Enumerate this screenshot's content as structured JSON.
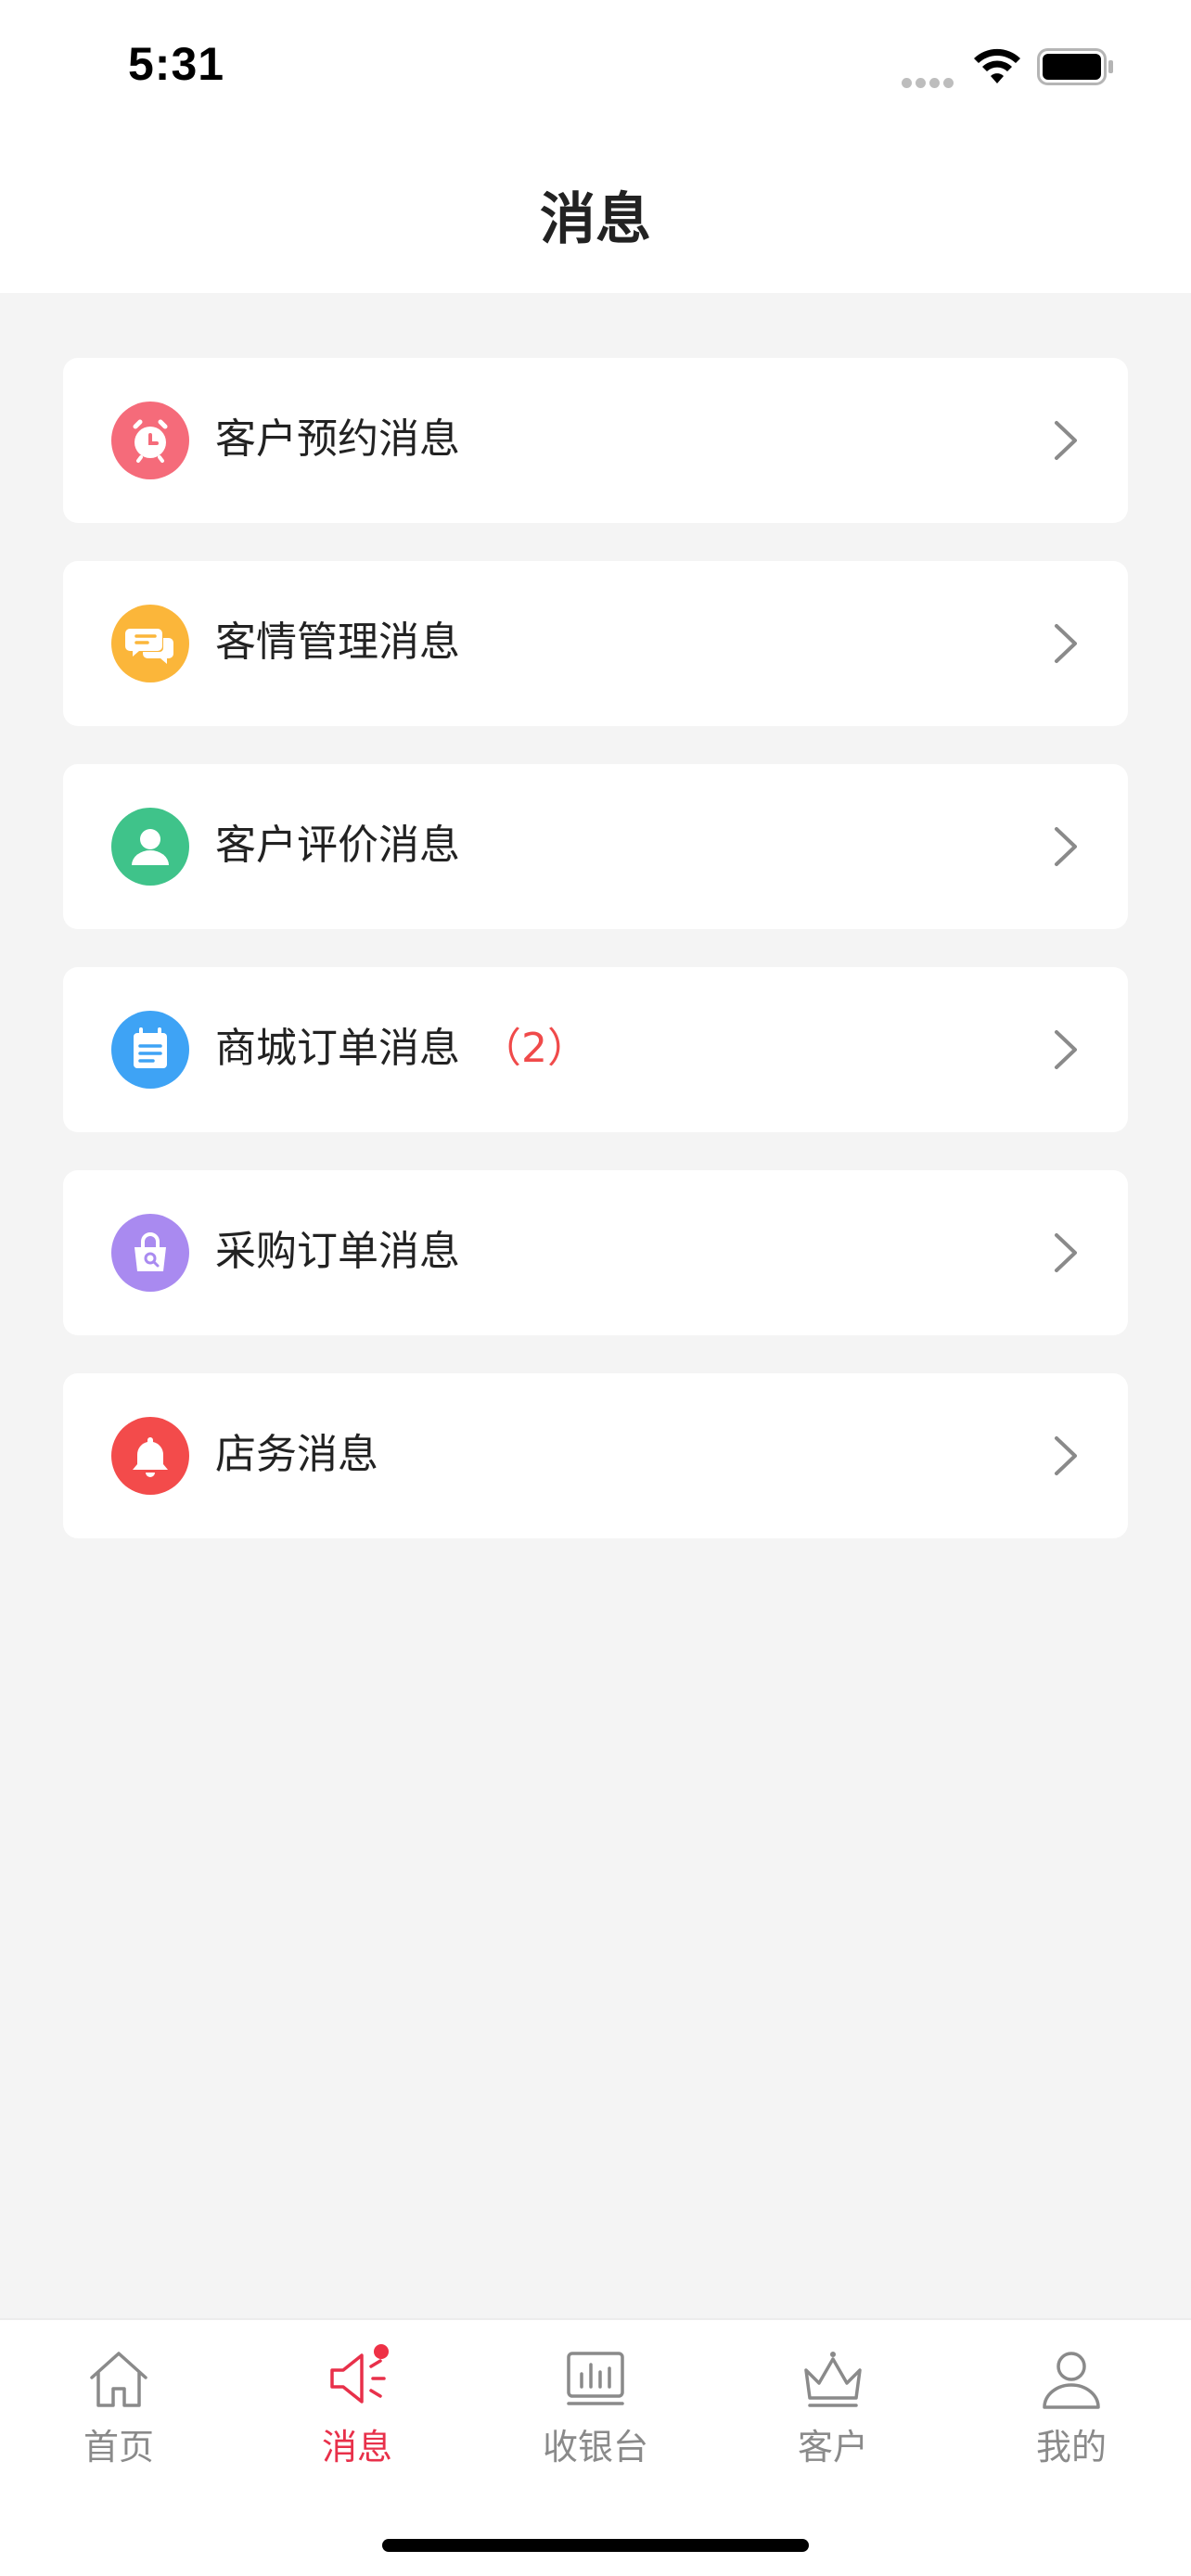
{
  "status_bar": {
    "time": "5:31",
    "icons": [
      "signal-icon",
      "wifi-icon",
      "battery-icon"
    ]
  },
  "header": {
    "title": "消息"
  },
  "messages": [
    {
      "label": "客户预约消息",
      "count": "",
      "icon": "alarm-clock-icon",
      "icon_color": "#f56b7a"
    },
    {
      "label": "客情管理消息",
      "count": "",
      "icon": "chat-bubbles-icon",
      "icon_color": "#fbb63a"
    },
    {
      "label": "客户评价消息",
      "count": "",
      "icon": "user-icon",
      "icon_color": "#3fc38a"
    },
    {
      "label": "商城订单消息",
      "count": "（2）",
      "icon": "order-notepad-icon",
      "icon_color": "#3ea3f5"
    },
    {
      "label": "采购订单消息",
      "count": "",
      "icon": "shopping-bag-icon",
      "icon_color": "#a98af0"
    },
    {
      "label": "店务消息",
      "count": "",
      "icon": "bell-icon",
      "icon_color": "#f34b4b"
    }
  ],
  "tab_bar": {
    "items": [
      {
        "label": "首页",
        "icon": "home-icon",
        "active": false
      },
      {
        "label": "消息",
        "icon": "megaphone-icon",
        "active": true
      },
      {
        "label": "收银台",
        "icon": "cash-register-icon",
        "active": false
      },
      {
        "label": "客户",
        "icon": "crown-icon",
        "active": false
      },
      {
        "label": "我的",
        "icon": "profile-icon",
        "active": false
      }
    ],
    "active_color": "#e8304a",
    "inactive_color": "#8a8a8a"
  }
}
